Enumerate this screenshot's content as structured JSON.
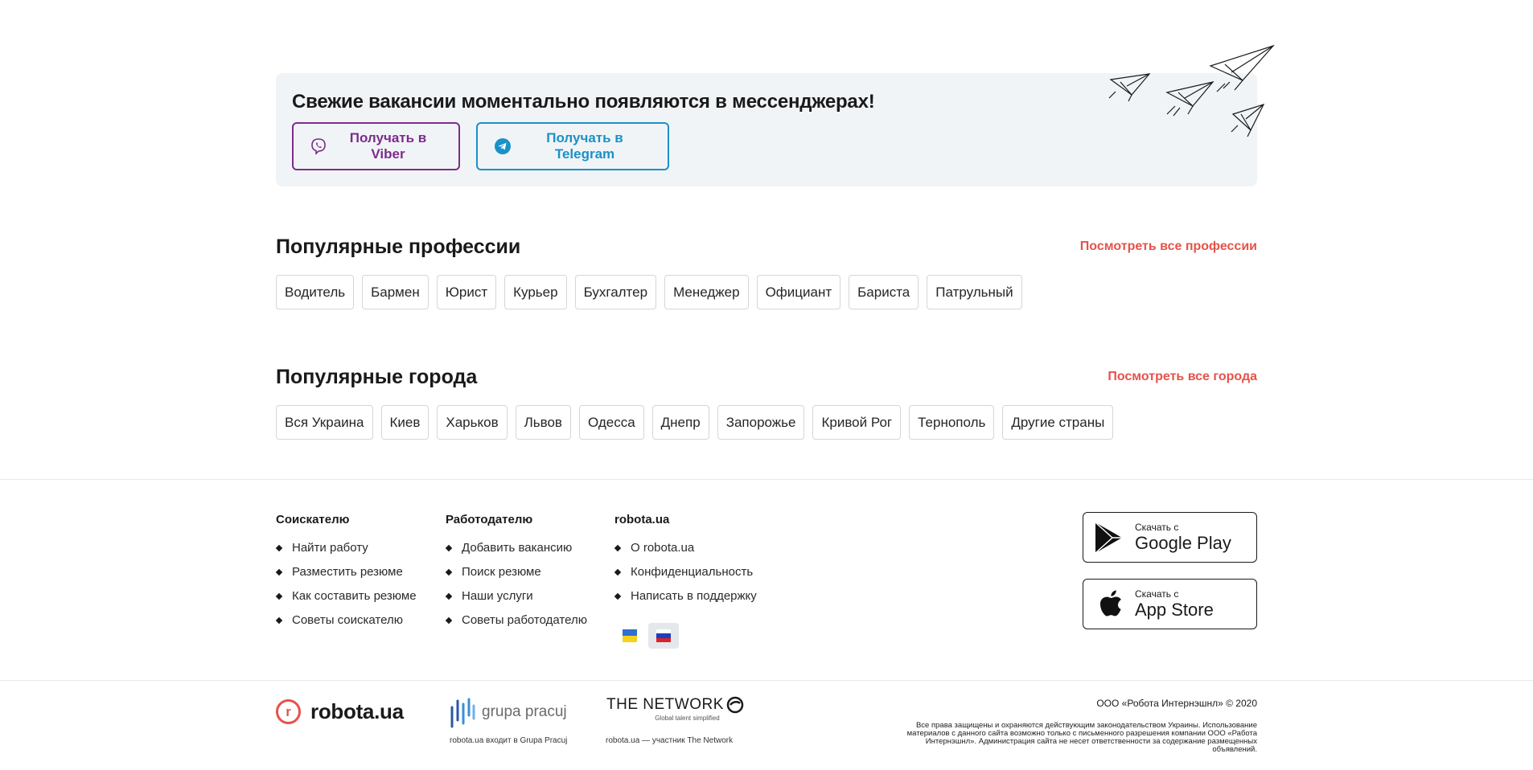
{
  "banner": {
    "title": "Свежие вакансии моментально появляются в мессенджерах!",
    "viber_label": "Получать в Viber",
    "telegram_label": "Получать в Telegram",
    "colors": {
      "viber": "#7d2b8b",
      "telegram": "#1a91c7",
      "background": "#f1f4f7"
    }
  },
  "professions": {
    "title": "Популярные профессии",
    "link": "Посмотреть все профессии",
    "items": [
      "Водитель",
      "Бармен",
      "Юрист",
      "Курьер",
      "Бухгалтер",
      "Менеджер",
      "Официант",
      "Бариста",
      "Патрульный"
    ]
  },
  "cities": {
    "title": "Популярные города",
    "link": "Посмотреть все города",
    "items": [
      "Вся Украина",
      "Киев",
      "Харьков",
      "Львов",
      "Одесса",
      "Днепр",
      "Запорожье",
      "Кривой Рог",
      "Тернополь",
      "Другие страны"
    ]
  },
  "footer": {
    "seeker": {
      "title": "Соискателю",
      "links": [
        "Найти работу",
        "Разместить резюме",
        "Как составить резюме",
        "Советы соискателю"
      ]
    },
    "employer": {
      "title": "Работодателю",
      "links": [
        "Добавить вакансию",
        "Поиск резюме",
        "Наши услуги",
        "Советы работодателю"
      ]
    },
    "robota": {
      "title": "robota.ua",
      "links": [
        "О robota.ua",
        "Конфиденциальность",
        "Написать в поддержку"
      ]
    },
    "languages": {
      "active": "ru",
      "items": [
        "ua-flag",
        "ru-flag"
      ]
    },
    "google_play": {
      "small": "Скачать с",
      "big": "Google Play"
    },
    "app_store": {
      "small": "Скачать с",
      "big": "App Store"
    }
  },
  "bottom": {
    "logo_text": "robota.ua",
    "logo_letter": "r",
    "gp_text": "grupa pracuj",
    "gp_caption": "robota.ua входит в Grupa Pracuj",
    "network_text": "THE NETWORK",
    "network_tagline": "Global talent simplified",
    "network_caption": "robota.ua — участник The Network",
    "copyright": "ООО «Робота Интернэшнл» © 2020",
    "legal": "Все права защищены и охраняются действующим законодательством Украины. Использование материалов с данного сайта возможно только с письменного разрешения компании ООО «Работа Интернэшнл». Администрация сайта не несет ответственности за содержание размещенных объявлений."
  },
  "accent_color": "#e5534b"
}
